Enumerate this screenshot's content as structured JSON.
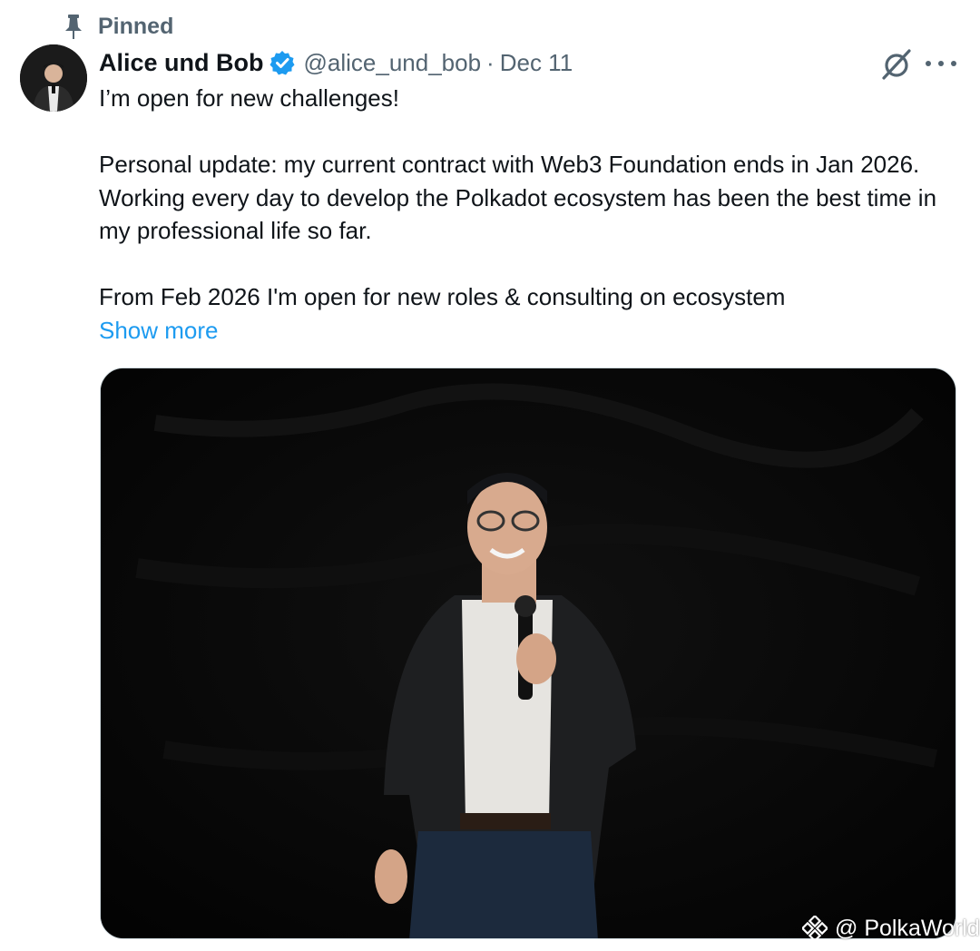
{
  "pinned": {
    "label": "Pinned",
    "icon": "pin-icon"
  },
  "author": {
    "display_name": "Alice und Bob",
    "handle": "@alice_und_bob",
    "separator": "·",
    "date": "Dec 11",
    "verified_color": "#1d9bf0"
  },
  "tweet": {
    "lines": [
      "I’m open for new challenges!",
      "Personal update: my current contract with Web3 Foundation ends in Jan 2026. Working every day to develop the Polkadot ecosystem has been the best time in my professional life so far.",
      "From Feb 2026 I'm open for new roles & consulting on ecosystem"
    ],
    "show_more": "Show more"
  },
  "media": {
    "alt": "photo"
  },
  "watermark": {
    "text": "@ PolkaWorld"
  },
  "colors": {
    "text": "#0f1419",
    "secondary": "#536471",
    "link": "#1d9bf0"
  }
}
